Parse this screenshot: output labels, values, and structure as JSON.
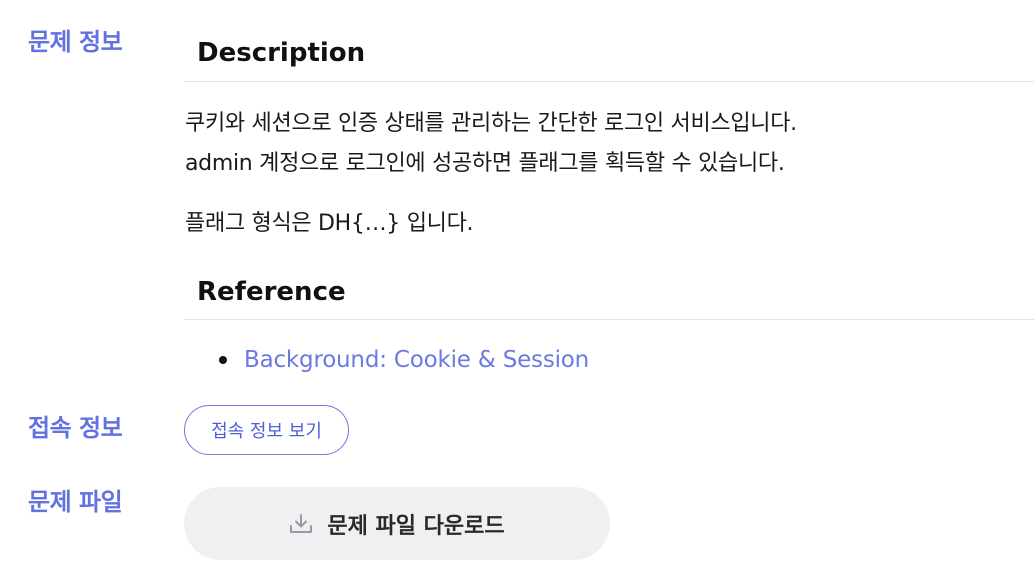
{
  "sections": {
    "info_label": "문제 정보",
    "connection_label": "접속 정보",
    "file_label": "문제 파일"
  },
  "description": {
    "heading": "Description",
    "line1": "쿠키와 세션으로 인증 상태를 관리하는 간단한 로그인 서비스입니다.",
    "line2": "admin 계정으로 로그인에 성공하면 플래그를 획득할 수 있습니다.",
    "line3": "플래그 형식은 DH{…} 입니다."
  },
  "reference": {
    "heading": "Reference",
    "items": [
      {
        "label": "Background: Cookie & Session"
      }
    ]
  },
  "connection": {
    "button_label": "접속 정보 보기"
  },
  "download": {
    "button_label": "문제 파일 다운로드",
    "icon": "download-icon"
  },
  "colors": {
    "accent": "#6272e0",
    "link": "#6b7ae0",
    "download_bg": "#f0f0f3"
  }
}
